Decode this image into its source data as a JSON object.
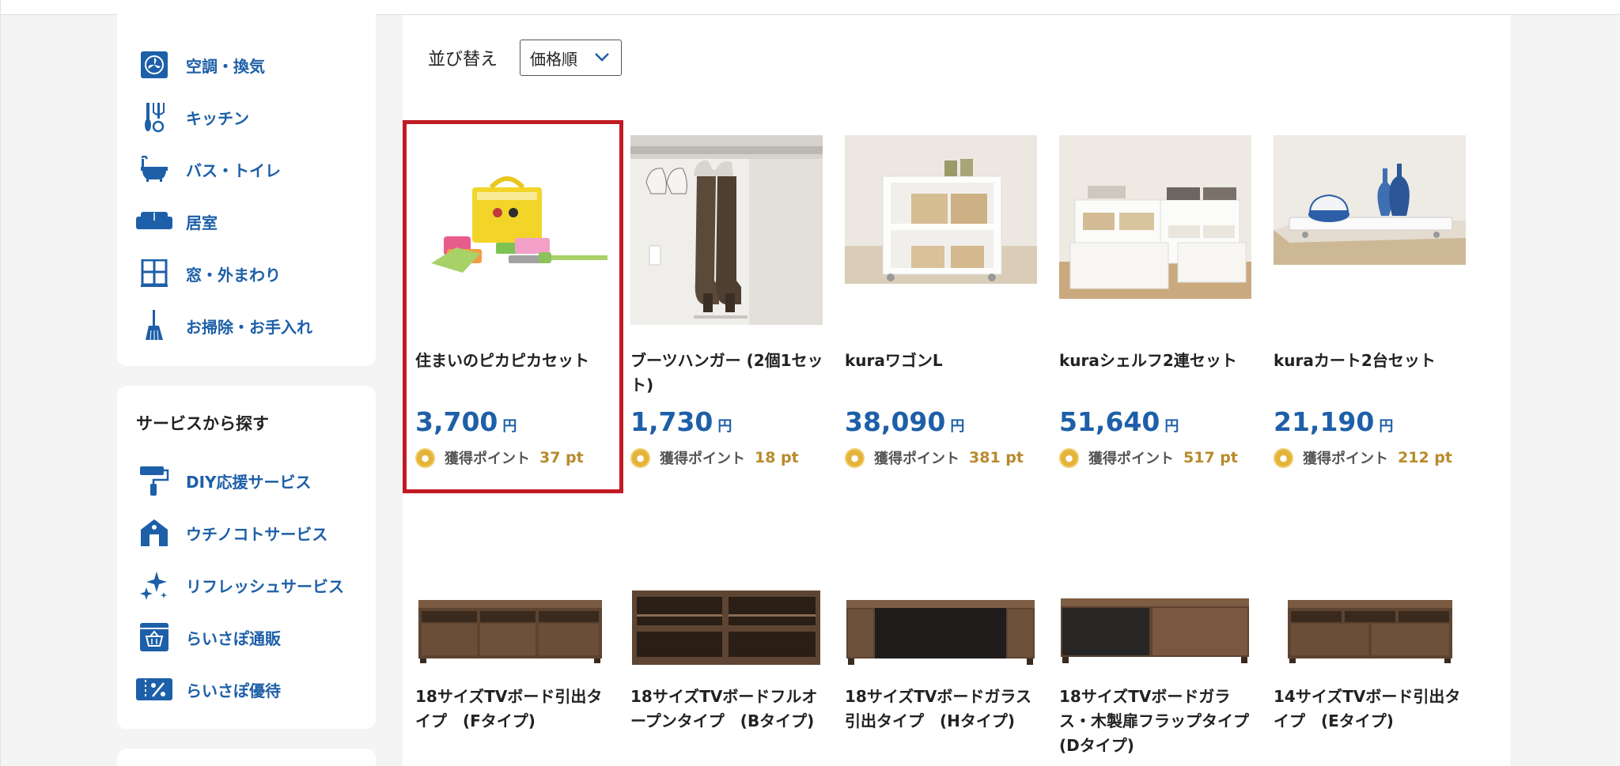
{
  "sidebar": {
    "categories": [
      {
        "label": "空調・換気",
        "icon": "fan-icon"
      },
      {
        "label": "キッチン",
        "icon": "kitchen-utensils-icon"
      },
      {
        "label": "バス・トイレ",
        "icon": "bathtub-icon"
      },
      {
        "label": "居室",
        "icon": "sofa-icon"
      },
      {
        "label": "窓・外まわり",
        "icon": "window-icon"
      },
      {
        "label": "お掃除・お手入れ",
        "icon": "broom-icon"
      }
    ],
    "services": {
      "title": "サービスから探す",
      "items": [
        {
          "label": "DIY応援サービス",
          "icon": "paint-roller-icon"
        },
        {
          "label": "ウチノコトサービス",
          "icon": "house-icon"
        },
        {
          "label": "リフレッシュサービス",
          "icon": "sparkle-icon"
        },
        {
          "label": "らいさぽ通販",
          "icon": "shopping-basket-icon"
        },
        {
          "label": "らいさぽ優待",
          "icon": "discount-ticket-icon"
        }
      ]
    }
  },
  "sort": {
    "label": "並び替え",
    "selected": "価格順"
  },
  "products": [
    {
      "name": "住まいのピカピカセット",
      "price": "3,700",
      "yen": "円",
      "points_label": "獲得ポイント",
      "points": "37 pt",
      "image": "cleaning-set-image",
      "selected": true
    },
    {
      "name": "ブーツハンガー (2個1セット)",
      "price": "1,730",
      "yen": "円",
      "points_label": "獲得ポイント",
      "points": "18 pt",
      "image": "boots-hanger-image",
      "selected": false
    },
    {
      "name": "kuraワゴンL",
      "price": "38,090",
      "yen": "円",
      "points_label": "獲得ポイント",
      "points": "381 pt",
      "image": "wagon-image",
      "selected": false
    },
    {
      "name": "kuraシェルフ2連セット",
      "price": "51,640",
      "yen": "円",
      "points_label": "獲得ポイント",
      "points": "517 pt",
      "image": "shelf-image",
      "selected": false
    },
    {
      "name": "kuraカート2台セット",
      "price": "21,190",
      "yen": "円",
      "points_label": "獲得ポイント",
      "points": "212 pt",
      "image": "cart-image",
      "selected": false
    },
    {
      "name": "18サイズTVボード引出タイプ　(Fタイプ)",
      "image": "tv-board-image"
    },
    {
      "name": "18サイズTVボードフルオープンタイプ　(Bタイプ)",
      "image": "tv-board-image"
    },
    {
      "name": "18サイズTVボードガラス引出タイプ　(Hタイプ)",
      "image": "tv-board-image"
    },
    {
      "name": "18サイズTVボードガラス・木製扉フラップタイプ　(Dタイプ)",
      "image": "tv-board-image"
    },
    {
      "name": "14サイズTVボード引出タイプ　(Eタイプ)",
      "image": "tv-board-image"
    }
  ],
  "colors": {
    "link_blue": "#1d5fa8",
    "price_blue": "#1d5fa8",
    "highlight_red": "#c01b24",
    "points_gold": "#b88a2b"
  }
}
